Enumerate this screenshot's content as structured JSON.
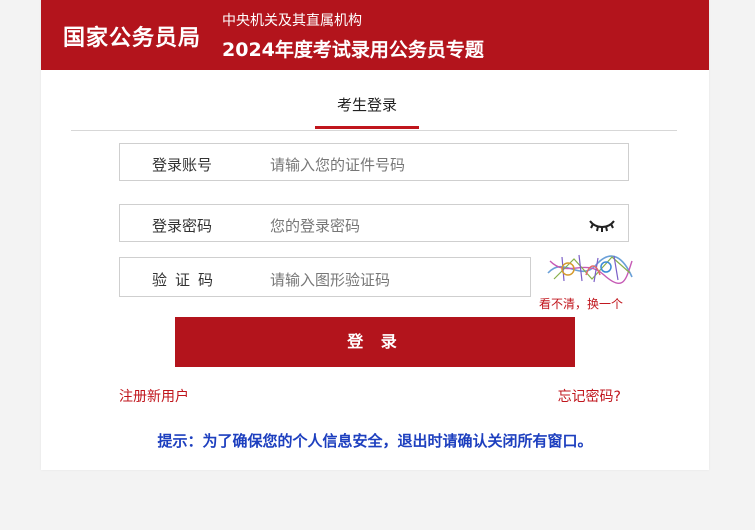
{
  "header": {
    "brand": "国家公务员局",
    "subtitle_top": "中央机关及其直属机构",
    "subtitle_main": "2024年度考试录用公务员专题"
  },
  "login_tab": {
    "label": "考生登录"
  },
  "form": {
    "account": {
      "label": "登录账号",
      "placeholder": "请输入您的证件号码"
    },
    "password": {
      "label": "登录密码",
      "placeholder": "您的登录密码"
    },
    "captcha": {
      "label": "验证码",
      "placeholder": "请输入图形验证码",
      "refresh_text": "看不清，换一个"
    }
  },
  "login_button": {
    "label": "登 录"
  },
  "links": {
    "register": "注册新用户",
    "forgot": "忘记密码?"
  },
  "notice": "提示：为了确保您的个人信息安全，退出时请确认关闭所有窗口。",
  "colors": {
    "accent": "#b3141c",
    "notice": "#1d3fbf"
  },
  "icons": {
    "password_toggle": "eye-closed-icon",
    "captcha": "captcha-image"
  }
}
